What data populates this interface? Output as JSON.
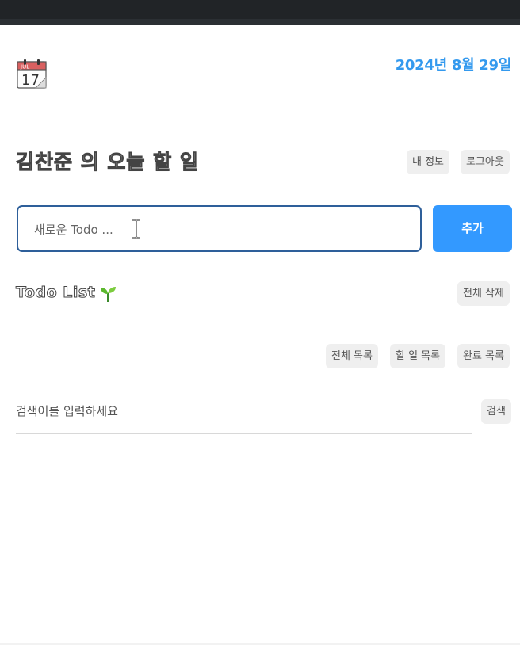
{
  "header": {
    "date": "2024년 8월 29일",
    "calendar_icon": "calendar-icon",
    "calendar_month": "JUL",
    "calendar_day": "17"
  },
  "title": "김찬준 의 오늘 할 일",
  "account": {
    "my_info_label": "내 정보",
    "logout_label": "로그아웃"
  },
  "todo_input": {
    "placeholder": "새로운 Todo ...",
    "value": "",
    "add_label": "추가"
  },
  "list": {
    "title": "Todo List",
    "title_icon": "sprout-icon",
    "delete_all_label": "전체 삭제",
    "filters": [
      "전체 목록",
      "할 일 목록",
      "완료 목록"
    ]
  },
  "search": {
    "label": "검색어를 입력하세요",
    "button_label": "검색"
  },
  "colors": {
    "accent": "#3399ff",
    "date": "#3399ee",
    "input_border": "#2e5f9a",
    "button_bg": "#efefef"
  }
}
